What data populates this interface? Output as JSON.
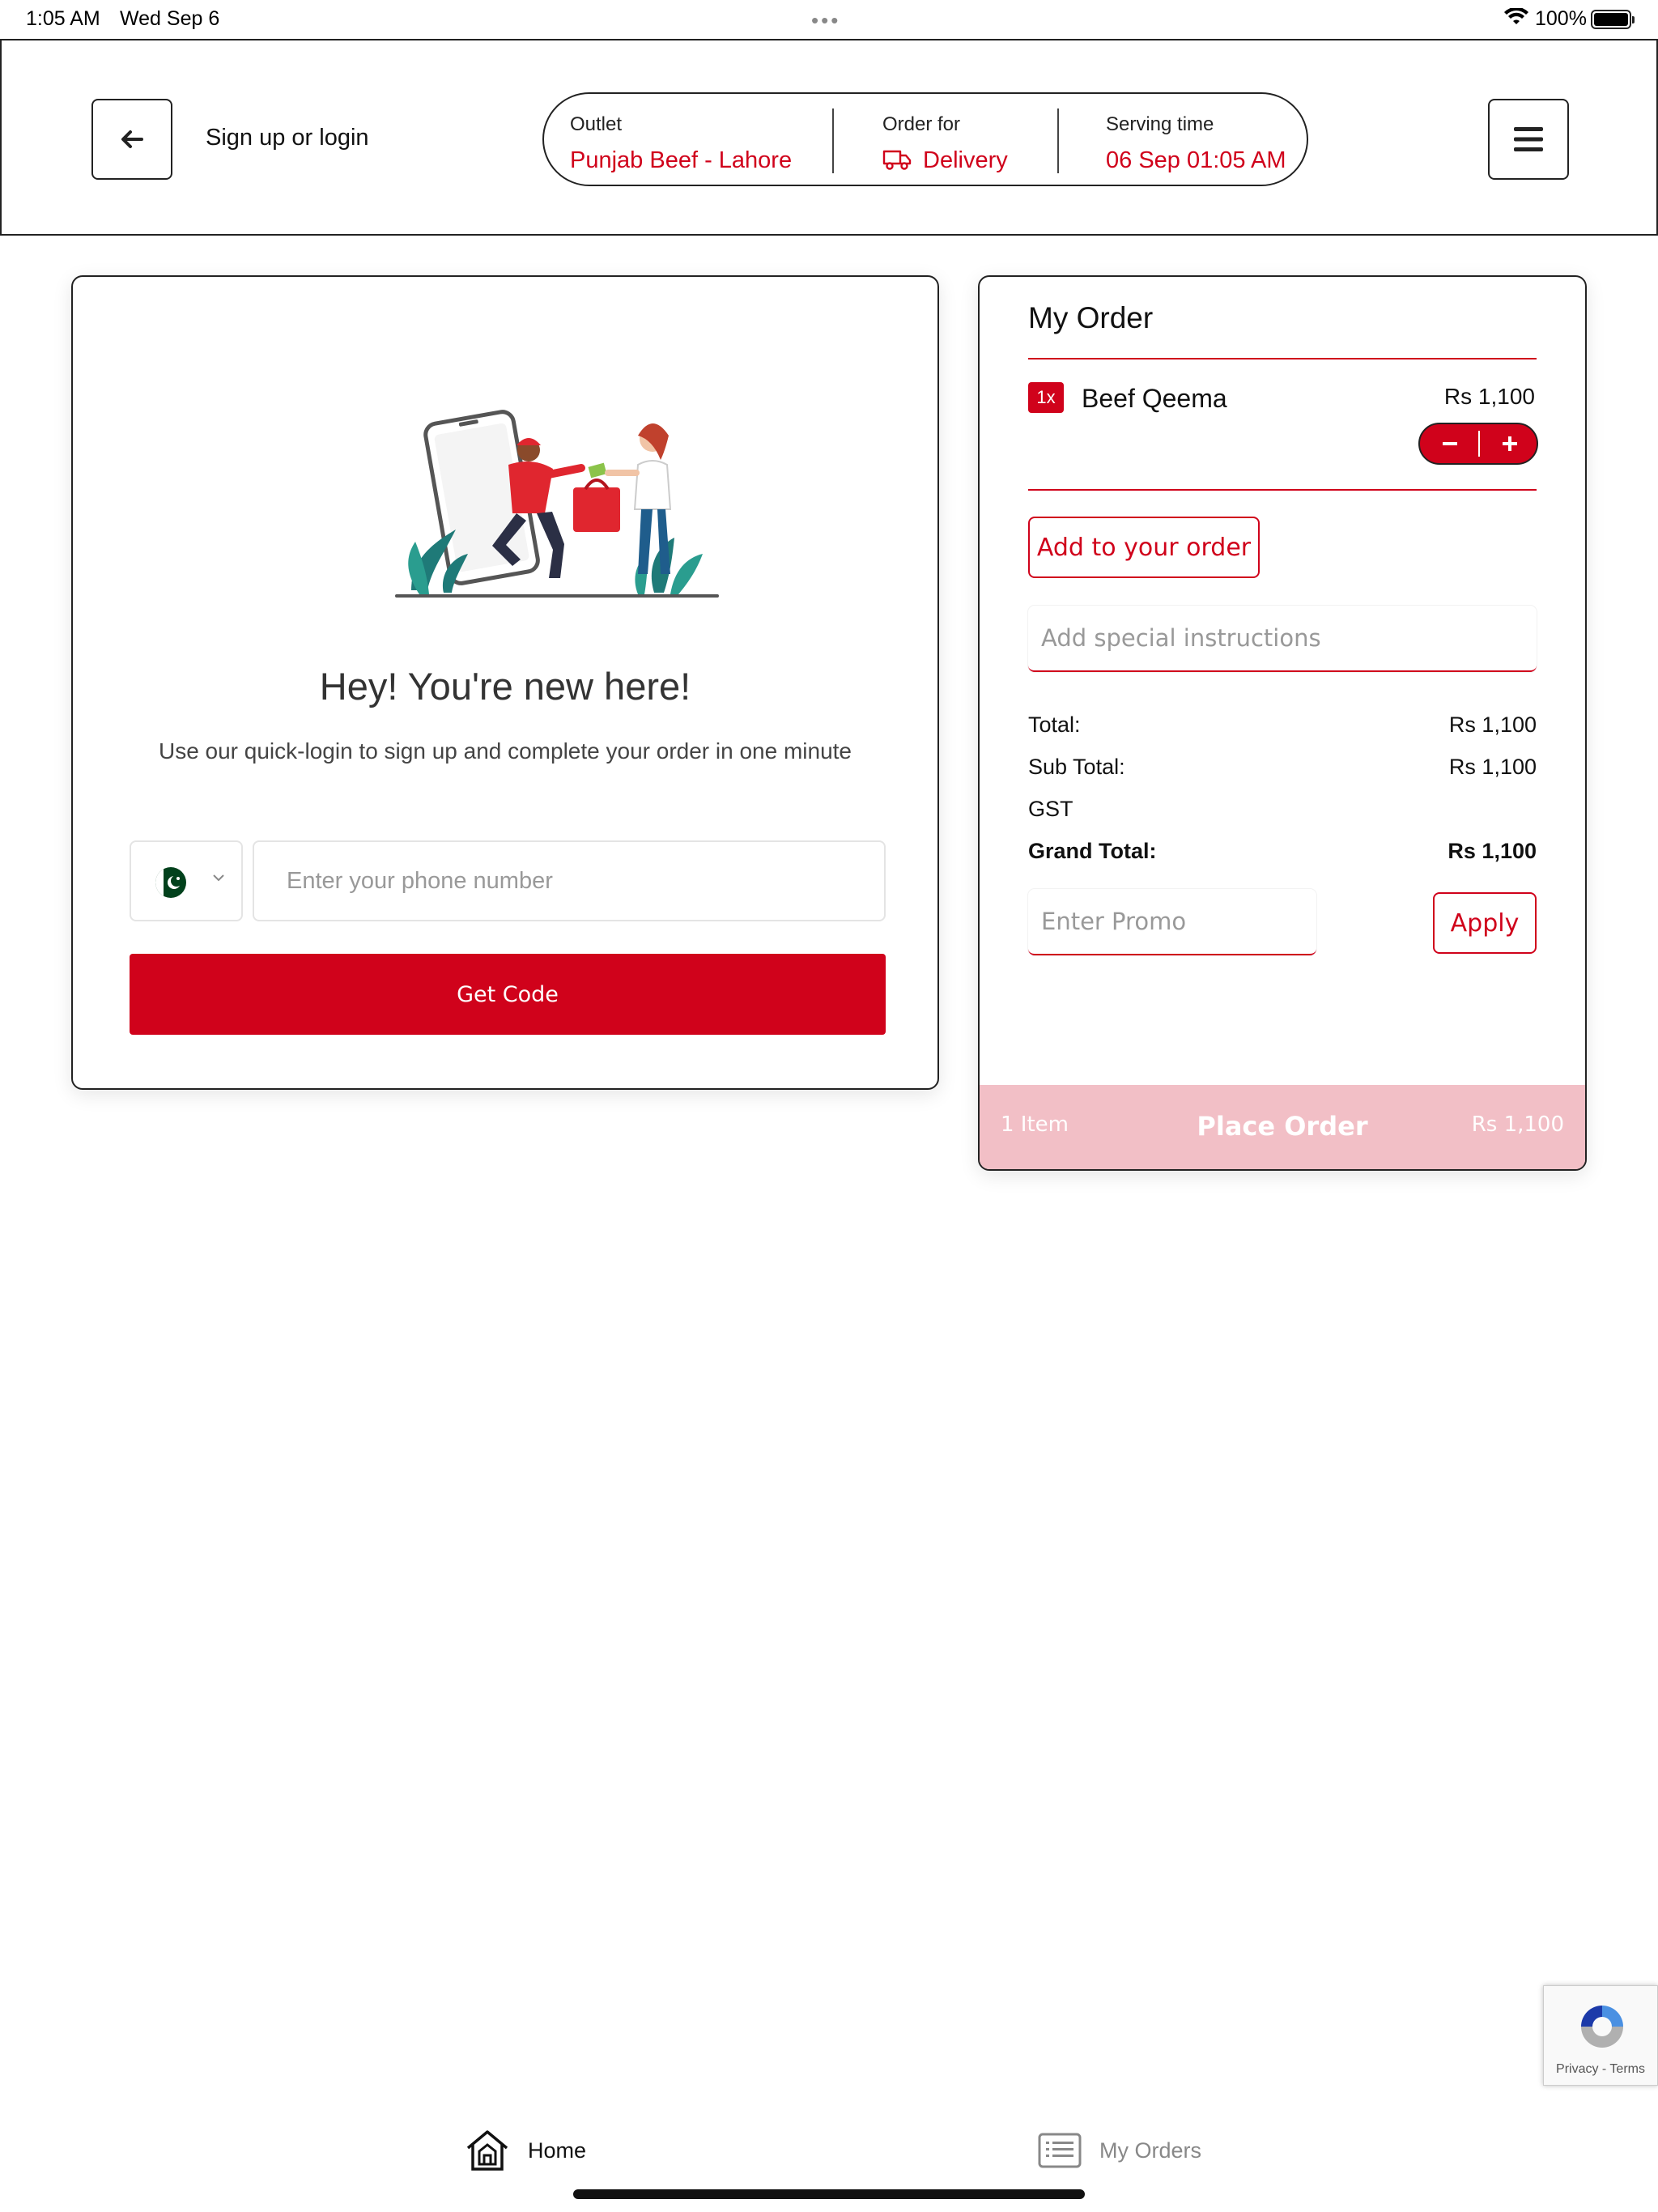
{
  "status_bar": {
    "time": "1:05 AM",
    "date": "Wed Sep 6",
    "battery": "100%"
  },
  "header": {
    "title": "Sign up or login",
    "back_icon": "arrow-left-icon",
    "menu_icon": "hamburger-menu-icon",
    "outlet_label": "Outlet",
    "outlet_value": "Punjab Beef - Lahore",
    "order_for_label": "Order for",
    "order_for_value": "Delivery",
    "order_for_icon": "truck-icon",
    "serving_label": "Serving time",
    "serving_value": "06 Sep 01:05 AM"
  },
  "login": {
    "illustration": "delivery-illustration",
    "heading": "Hey! You're new here!",
    "subtext": "Use our quick-login to sign up and complete your order in one minute",
    "country_flag": "pakistan-flag-icon",
    "phone_placeholder": "Enter your phone number",
    "get_code": "Get Code"
  },
  "order": {
    "title": "My Order",
    "items": [
      {
        "qty": "1x",
        "name": "Beef Qeema",
        "price": "Rs 1,100"
      }
    ],
    "add_to_order": "Add to your order",
    "instructions_placeholder": "Add special instructions",
    "summary": {
      "total_label": "Total:",
      "total_value": "Rs 1,100",
      "subtotal_label": "Sub Total:",
      "subtotal_value": "Rs 1,100",
      "gst_label": "GST",
      "grand_label": "Grand Total:",
      "grand_value": "Rs 1,100"
    },
    "promo_placeholder": "Enter Promo",
    "apply": "Apply",
    "place_bar": {
      "items": "1 Item",
      "label": "Place Order",
      "total": "Rs 1,100"
    }
  },
  "recaptcha": {
    "links": "Privacy - Terms"
  },
  "tabbar": {
    "home": "Home",
    "my_orders": "My Orders"
  },
  "colors": {
    "accent": "#d0021b",
    "place_order_disabled": "#f2bfc6"
  }
}
